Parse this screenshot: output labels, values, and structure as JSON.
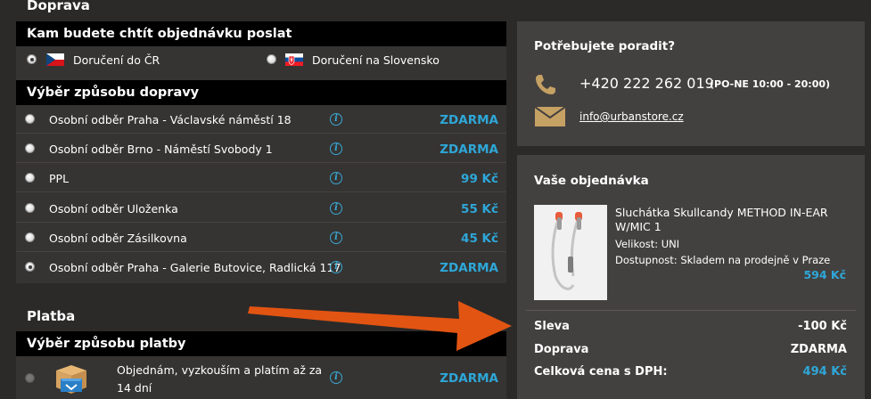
{
  "colors": {
    "accent_blue": "#2ea7d8",
    "gold": "#c6a164",
    "arrow_orange": "#e25412",
    "background": "#2b2a29",
    "panel": "#434140"
  },
  "shipping": {
    "section_title": "Doprava",
    "destination_header": "Kam budete chtít objednávku poslat",
    "destinations": [
      {
        "label": "Doručení do ČR",
        "flag": "czech-flag-icon",
        "checked": true
      },
      {
        "label": "Doručení na Slovensko",
        "flag": "slovak-flag-icon",
        "checked": false
      }
    ],
    "method_header": "Výběr způsobu dopravy",
    "methods": [
      {
        "label": "Osobní odběr Praha - Václavské náměstí 18",
        "price": "ZDARMA",
        "checked": false
      },
      {
        "label": "Osobní odběr Brno - Náměstí Svobody 1",
        "price": "ZDARMA",
        "checked": false
      },
      {
        "label": "PPL",
        "price": "99 Kč",
        "checked": false
      },
      {
        "label": "Osobní odběr Uloženka",
        "price": "55 Kč",
        "checked": false
      },
      {
        "label": "Osobní odběr Zásilkovna",
        "price": "45 Kč",
        "checked": false
      },
      {
        "label": "Osobní odběr Praha - Galerie Butovice, Radlická 117",
        "price": "ZDARMA",
        "checked": true
      }
    ]
  },
  "payment": {
    "section_title": "Platba",
    "method_header": "Výběr způsobu platby",
    "methods": [
      {
        "label_line1": "Objednám, vyzkouším a platím až za",
        "label_line2": "14 dní",
        "price": "ZDARMA",
        "icon": "package-box-icon"
      }
    ]
  },
  "help": {
    "title": "Potřebujete poradit?",
    "phone": "+420 222 262 019",
    "hours": "(PO-NE 10:00 - 20:00)",
    "email": "info@urbanstore.cz"
  },
  "order": {
    "title": "Vaše objednávka",
    "product": {
      "name": "Sluchátka Skullcandy METHOD IN-EAR W/MIC 1",
      "size_label": "Velikost: UNI",
      "availability_label": "Dostupnost: Skladem na prodejně v Praze",
      "price": "594 Kč"
    },
    "summary": [
      {
        "label": "Sleva",
        "value": "-100 Kč",
        "highlight": false
      },
      {
        "label": "Doprava",
        "value": "ZDARMA",
        "highlight": false
      },
      {
        "label": "Celková cena s DPH:",
        "value": "494 Kč",
        "highlight": true
      }
    ]
  }
}
